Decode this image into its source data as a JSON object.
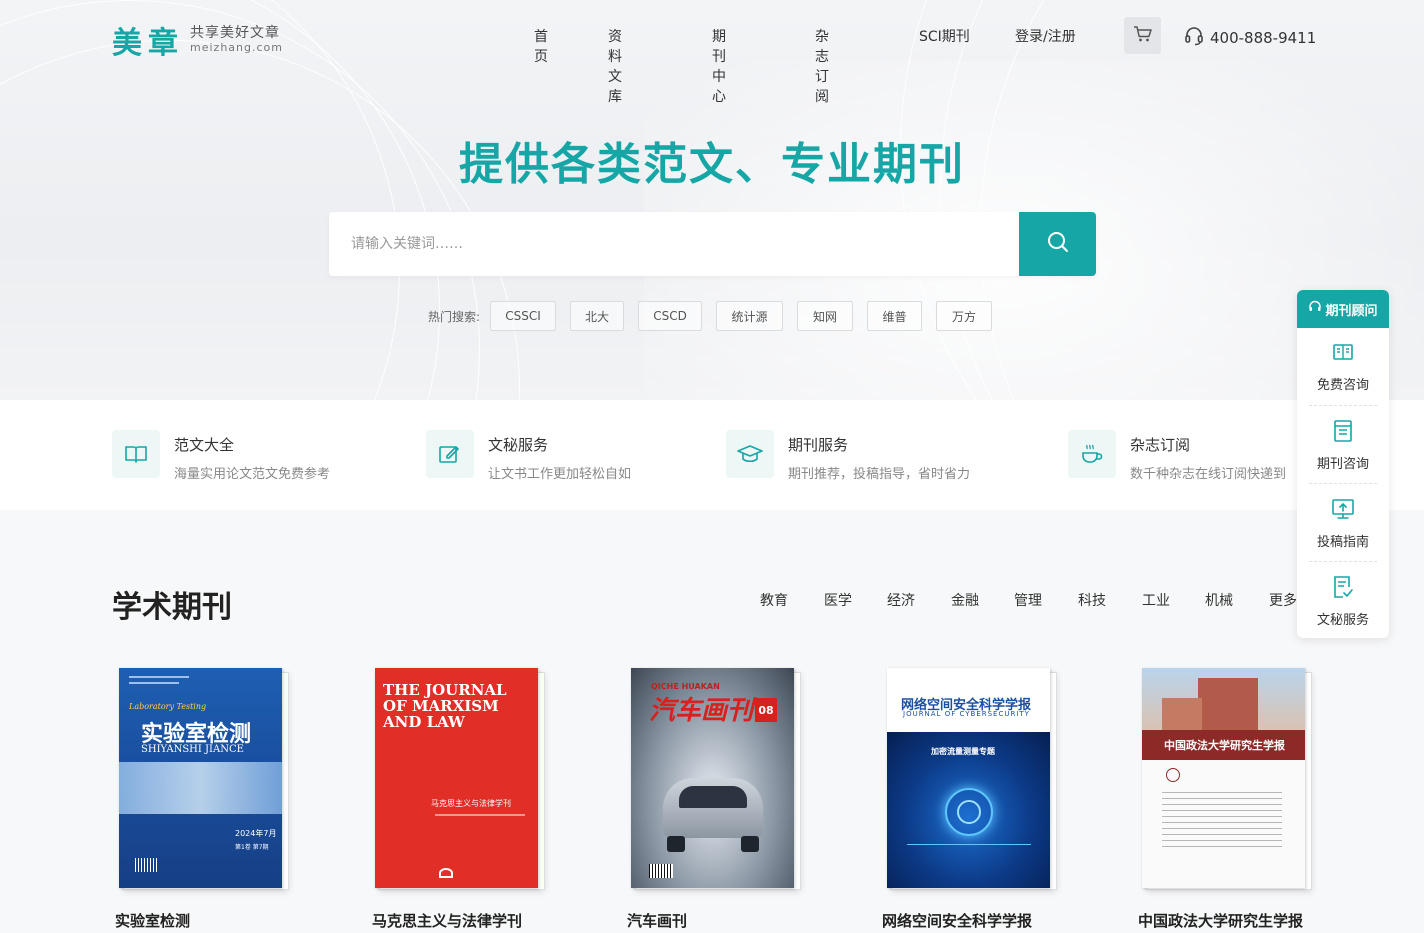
{
  "brand": {
    "logo_mark": "美章",
    "slogan": "共享美好文章",
    "domain": "meizhang.com",
    "accent_color": "#16a6a6"
  },
  "nav": {
    "items": [
      "首页",
      "资料文库",
      "期刊中心",
      "杂志订阅",
      "SCI期刊",
      "登录/注册"
    ],
    "cart_icon": "cart-icon",
    "phone": "400-888-9411"
  },
  "hero": {
    "title": "提供各类范文、专业期刊",
    "search_placeholder": "请输入关键词……",
    "hot_label": "热门搜索:",
    "hot_tags": [
      "CSSCI",
      "北大",
      "CSCD",
      "统计源",
      "知网",
      "维普",
      "万方"
    ]
  },
  "services": [
    {
      "icon": "book-open-icon",
      "title": "范文大全",
      "desc": "海量实用论文范文免费参考"
    },
    {
      "icon": "edit-icon",
      "title": "文秘服务",
      "desc": "让文书工作更加轻松自如"
    },
    {
      "icon": "graduation-cap-icon",
      "title": "期刊服务",
      "desc": "期刊推荐，投稿指导，省时省力"
    },
    {
      "icon": "cup-icon",
      "title": "杂志订阅",
      "desc": "数千种杂志在线订阅快递到"
    }
  ],
  "journals": {
    "title": "学术期刊",
    "categories": [
      "教育",
      "医学",
      "经济",
      "金融",
      "管理",
      "科技",
      "工业",
      "机械",
      "更多"
    ],
    "books": [
      {
        "name": "实验室检测",
        "cover_title": "实验室检测",
        "cover_en": "Laboratory Testing",
        "cover_pinyin": "SHIYANSHI JIANCE",
        "cover_date": "2024年7月",
        "cover_issue": "第1卷 第7期"
      },
      {
        "name": "马克思主义与法律学刊",
        "cover_title": "THE JOURNAL OF MARXISM AND LAW",
        "cover_sub": "马克思主义与法律学刊"
      },
      {
        "name": "汽车画刊",
        "cover_title": "汽车画刊",
        "cover_en": "QICHE HUAKAN",
        "cover_issue": "08"
      },
      {
        "name": "网络空间安全科学学报",
        "cover_title": "网络空间安全科学学报",
        "cover_en": "JOURNAL OF CYBERSECURITY",
        "cover_sub": "加密流量测量专题"
      },
      {
        "name": "中国政法大学研究生学报",
        "cover_title": "中国政法大学研究生学报"
      }
    ]
  },
  "float_panel": {
    "head": "期刊顾问",
    "items": [
      {
        "icon": "consult-icon",
        "label": "免费咨询"
      },
      {
        "icon": "journal-icon",
        "label": "期刊咨询"
      },
      {
        "icon": "upload-icon",
        "label": "投稿指南"
      },
      {
        "icon": "document-icon",
        "label": "文秘服务"
      }
    ]
  }
}
